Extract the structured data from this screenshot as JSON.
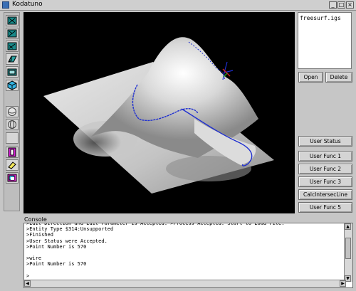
{
  "window": {
    "title": "Kodatuno",
    "controls": [
      "_",
      "□",
      "×"
    ]
  },
  "toolbar": {
    "icons": [
      "view-top-icon",
      "view-front-icon",
      "view-side-icon",
      "view-iso-icon",
      "view-fit-icon",
      "cube-icon",
      "shade-sphere-icon",
      "wire-sphere-icon",
      "blank-icon",
      "select-icon",
      "eraser-icon",
      "color-icon"
    ]
  },
  "files": {
    "items": [
      "freesurf.igs"
    ]
  },
  "buttons": {
    "open": "Open",
    "delete": "Delete",
    "user_status": "User Status",
    "user_func_1": "User Func 1",
    "user_func_2": "User Func 2",
    "user_func_3": "User Func 3",
    "calc_intersec": "CalcIntersecLine",
    "user_func_5": "User Func 5"
  },
  "console": {
    "label": "Console",
    "text": ">Edit Direction and Edit Parameter is Accepted. >Process Accepted. Start to Load File.\n>Entity Type $314:Unsupported\n>Finished\n>User Status were Accepted.\n>Point Number is 570\n\n>wire\n>Point Number is 570\n\n>"
  },
  "colors": {
    "viewport_bg": "#000000",
    "curve": "#1f2fd0",
    "surface": "#bfbfbf"
  }
}
